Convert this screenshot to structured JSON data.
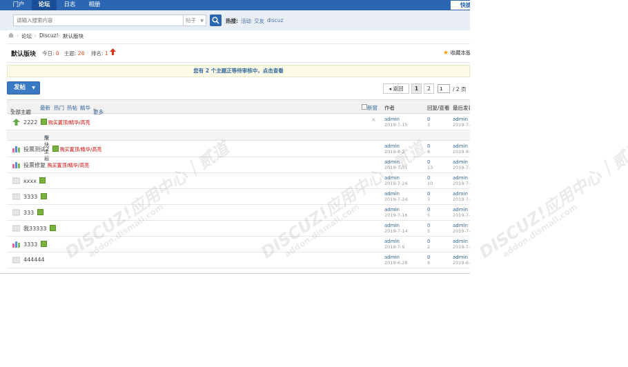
{
  "nav": {
    "tabs": [
      "门户",
      "论坛",
      "日志",
      "相册"
    ],
    "active": "论坛",
    "quick": "快捷"
  },
  "search": {
    "placeholder": "请输入搜索内容",
    "type": "帖子",
    "hot_label": "热搜:",
    "hot_links": [
      "活动",
      "交友",
      "discuz"
    ]
  },
  "breadcrumb": [
    "论坛",
    "Discuz!",
    "默认版块"
  ],
  "forum": {
    "title": "默认版块",
    "today_label": "今日:",
    "today": "0",
    "topics_label": "主题:",
    "topics": "26",
    "rank_label": "排名:",
    "rank": "1",
    "favorite": "收藏本版"
  },
  "notice": "您有 2 个主题正等待审核中，点击查看",
  "toolbar": {
    "post": "发帖",
    "prev": "返回",
    "pages": [
      "1",
      "2"
    ],
    "page_input": "1",
    "page_total": "/ 2 页"
  },
  "list_header": {
    "filters": [
      "全部主题",
      "最新",
      "热门",
      "热帖",
      "精华",
      "更多"
    ],
    "new_label": "新窗",
    "author": "作者",
    "replies": "回复/查看",
    "last": "最后发表"
  },
  "subhead": "版块主题",
  "threads": [
    {
      "title": "2222",
      "tag": "购买置顶/精华/高亮",
      "author": "admin",
      "date": "2019-7-15",
      "replies": "0",
      "views": "3",
      "last": "admin",
      "last_date": "2019-7-"
    },
    {
      "title": "投票测试2",
      "tag": "购买置顶/精华/高亮",
      "author": "admin",
      "date": "2019-8-2",
      "replies": "0",
      "views": "8",
      "last": "admin",
      "last_date": "2019-8-"
    },
    {
      "title": "投票修复",
      "tag": "购买置顶/精华/高亮",
      "author": "admin",
      "date": "2019-7-31",
      "replies": "0",
      "views": "13",
      "last": "admin",
      "last_date": "2019-7-"
    },
    {
      "title": "xxxx",
      "tag": "",
      "author": "admin",
      "date": "2019-7-24",
      "replies": "0",
      "views": "10",
      "last": "admin",
      "last_date": "2019-7-"
    },
    {
      "title": "3333",
      "tag": "",
      "author": "admin",
      "date": "2019-7-24",
      "replies": "0",
      "views": "3",
      "last": "admin",
      "last_date": "2019-7-"
    },
    {
      "title": "333",
      "tag": "",
      "author": "admin",
      "date": "2019-7-16",
      "replies": "0",
      "views": "5",
      "last": "admin",
      "last_date": "2019-7-"
    },
    {
      "title": "我33333",
      "tag": "",
      "author": "admin",
      "date": "2019-7-14",
      "replies": "0",
      "views": "5",
      "last": "admin",
      "last_date": "2019-7-"
    },
    {
      "title": "3333",
      "tag": "",
      "author": "admin",
      "date": "2019-7-9",
      "replies": "0",
      "views": "2",
      "last": "admin",
      "last_date": "2019-7-"
    },
    {
      "title": "444444",
      "tag": "",
      "author": "admin",
      "date": "2019-6-28",
      "replies": "0",
      "views": "9",
      "last": "admin",
      "last_date": "2019-6-"
    }
  ],
  "watermark": {
    "brand": "DISCUZ!应用中心｜贰道",
    "url": "addon.dismall.com"
  }
}
